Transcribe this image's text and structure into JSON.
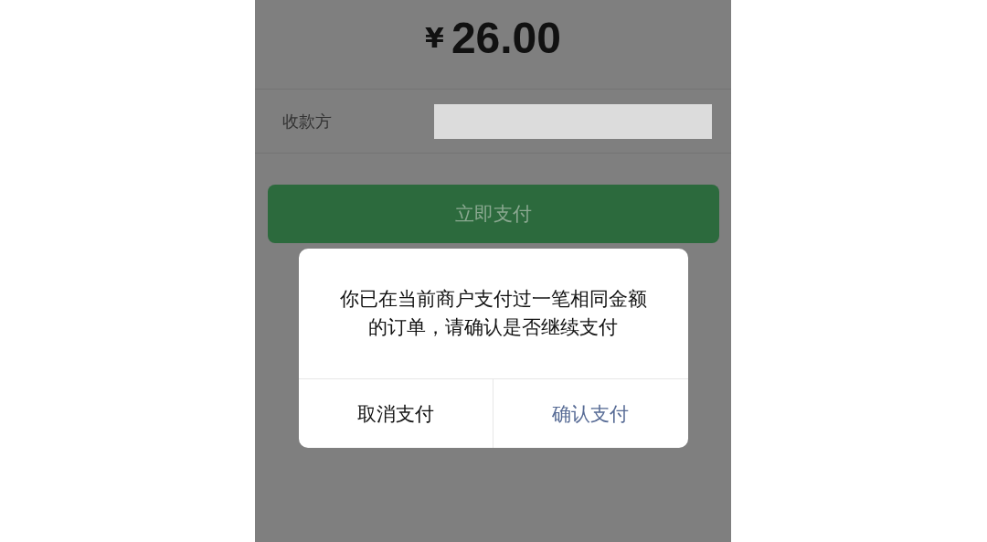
{
  "amount": {
    "currency": "¥",
    "value": "26.00"
  },
  "payee": {
    "label": "收款方"
  },
  "pay_button": {
    "label": "立即支付"
  },
  "dialog": {
    "message": "你已在当前商户支付过一笔相同金额的订单，请确认是否继续支付",
    "buttons": [
      {
        "label": "取消支付",
        "kind": "cancel"
      },
      {
        "label": "确认支付",
        "kind": "confirm"
      }
    ]
  }
}
